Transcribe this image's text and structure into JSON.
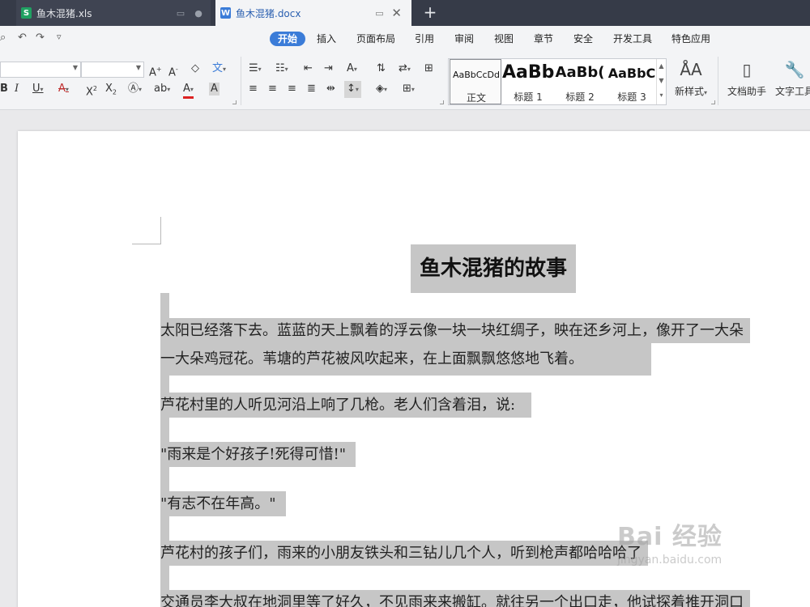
{
  "tabs": [
    {
      "title": "鱼木混猪.xls",
      "icon": "spreadsheet-icon",
      "icon_glyph": "S",
      "color": "#20a162",
      "state": "inactive"
    },
    {
      "title": "鱼木混猪.docx",
      "icon": "document-icon",
      "icon_glyph": "W",
      "color": "#3b7cd8",
      "state": "active"
    }
  ],
  "new_tab_glyph": "+",
  "quick_access": [
    "print-preview-icon",
    "undo-icon",
    "redo-icon",
    "customize-icon"
  ],
  "menu": {
    "items": [
      "开始",
      "插入",
      "页面布局",
      "引用",
      "审阅",
      "视图",
      "章节",
      "安全",
      "开发工具",
      "特色应用"
    ],
    "active": "开始",
    "accent": "#3b7cd8"
  },
  "ribbon": {
    "font_name": "",
    "font_size": "",
    "styles": [
      {
        "preview": "AaBbCcDd",
        "name": "正文"
      },
      {
        "preview": "AaBb",
        "name": "标题 1"
      },
      {
        "preview": "AaBb(",
        "name": "标题 2"
      },
      {
        "preview": "AaBbC",
        "name": "标题 3"
      }
    ],
    "new_style": "新样式",
    "doc_assistant": "文档助手",
    "text_tools": "文字工具"
  },
  "document": {
    "title": "鱼木混猪的故事",
    "paragraphs": [
      "太阳已经落下去。蓝蓝的天上飘着的浮云像一块一块红绸子，映在还乡河上，像开了一大朵",
      "一大朵鸡冠花。苇塘的芦花被风吹起来，在上面飘飘悠悠地飞着。",
      "芦花村里的人听见河沿上响了几枪。老人们含着泪，说:",
      "\"雨来是个好孩子!死得可惜!\"",
      "\"有志不在年高。\"",
      "芦花村的孩子们，雨来的小朋友铁头和三钻儿几个人，听到枪声都哈哈哈了",
      "交通员李大叔在地洞里等了好久，不见雨来来搬缸。就往另一个出口走，他试探着推开洞口"
    ],
    "highlight_color": "#c6c6c6"
  },
  "watermark": {
    "main": "Bai 经验",
    "url": "jingyan.baidu.com"
  }
}
